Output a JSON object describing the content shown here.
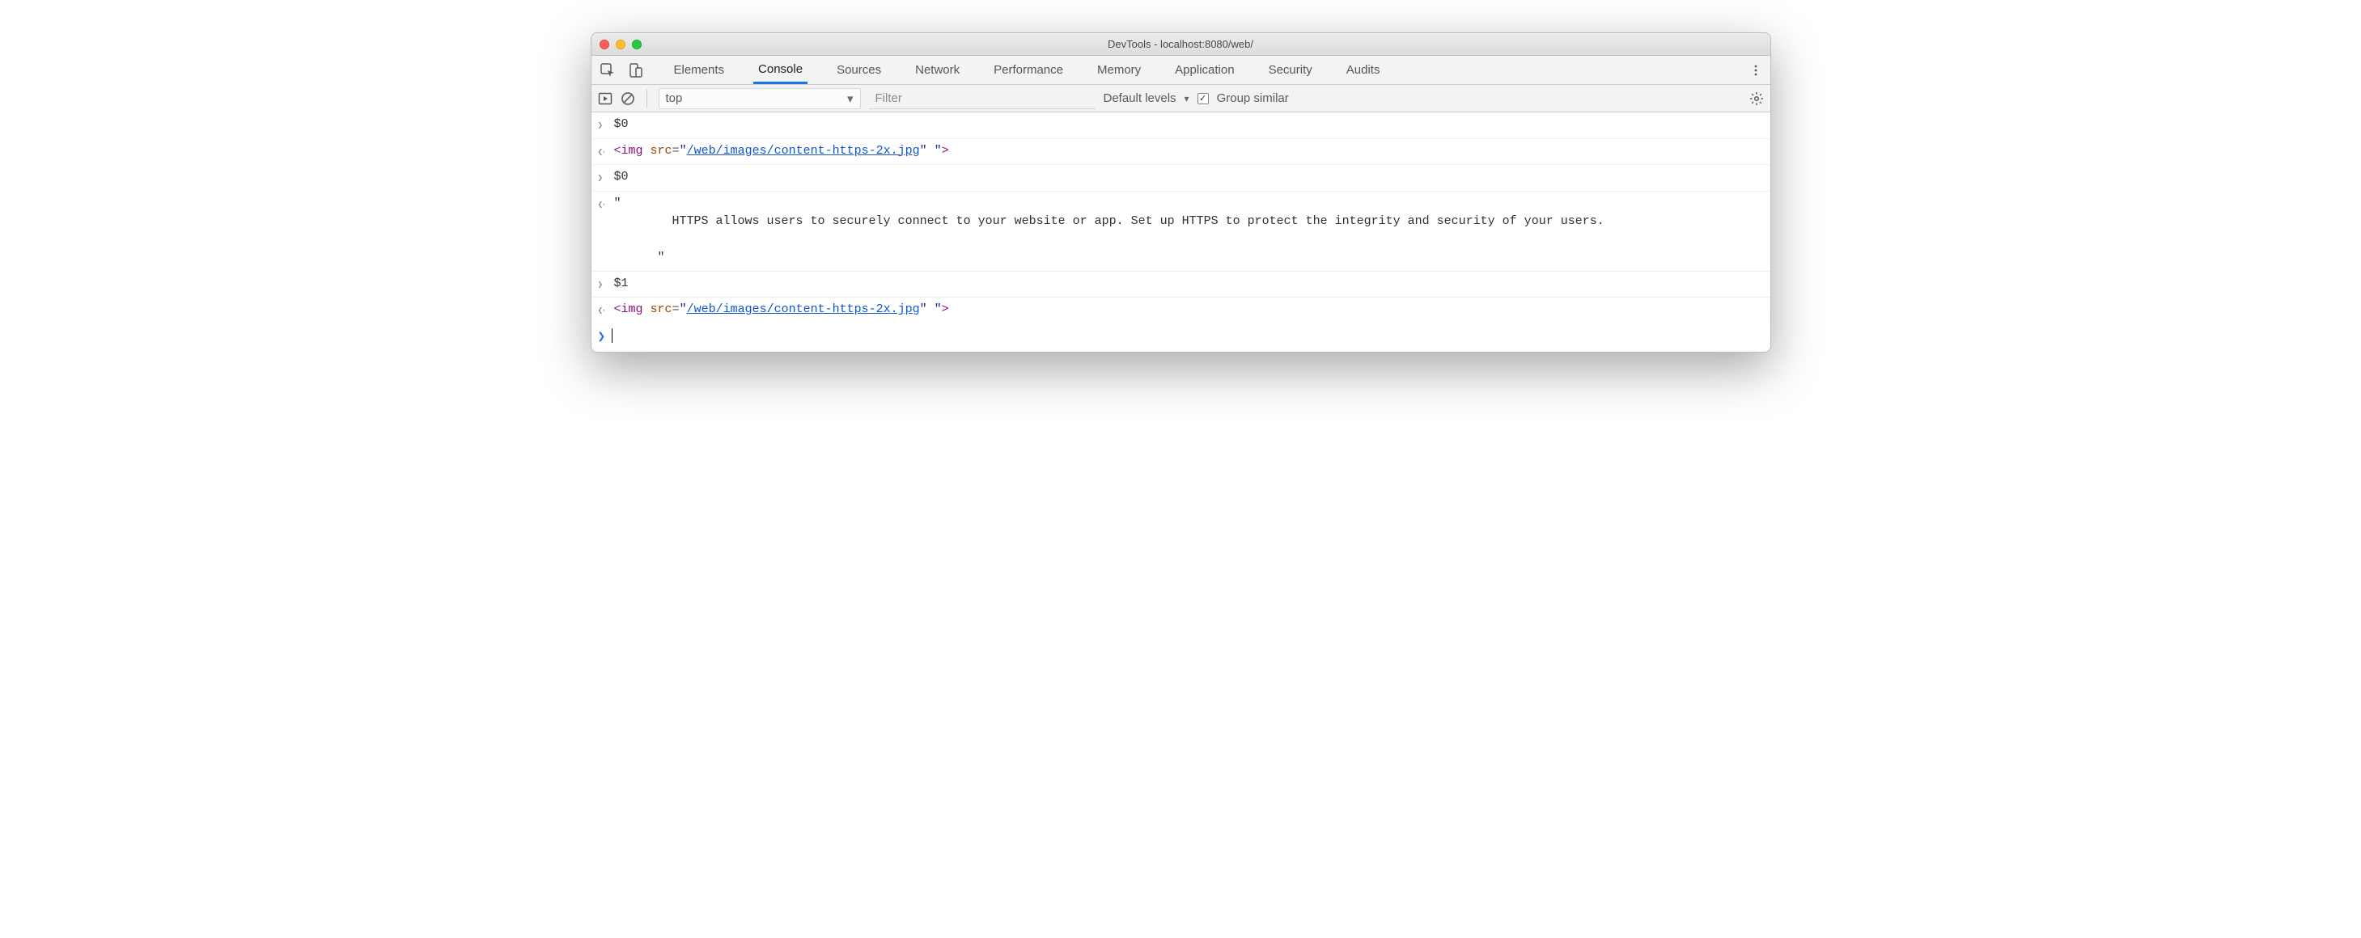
{
  "window": {
    "title": "DevTools - localhost:8080/web/"
  },
  "tabs": {
    "items": [
      "Elements",
      "Console",
      "Sources",
      "Network",
      "Performance",
      "Memory",
      "Application",
      "Security",
      "Audits"
    ],
    "active": "Console"
  },
  "toolbar": {
    "context": "top",
    "filter_placeholder": "Filter",
    "levels_label": "Default levels",
    "group_checked": true,
    "group_label": "Group similar"
  },
  "console": {
    "rows": [
      {
        "kind": "input",
        "text": "$0"
      },
      {
        "kind": "output",
        "htmlTag": "img",
        "attr": "src",
        "url": "/web/images/content-https-2x.jpg",
        "trail": " "
      },
      {
        "kind": "input",
        "text": "$0"
      },
      {
        "kind": "output",
        "plain": "\"\n        HTTPS allows users to securely connect to your website or app. Set up HTTPS to protect the integrity and security of your users.\n\n      \""
      },
      {
        "kind": "input",
        "text": "$1"
      },
      {
        "kind": "output",
        "htmlTag": "img",
        "attr": "src",
        "url": "/web/images/content-https-2x.jpg",
        "trail": " "
      }
    ]
  }
}
